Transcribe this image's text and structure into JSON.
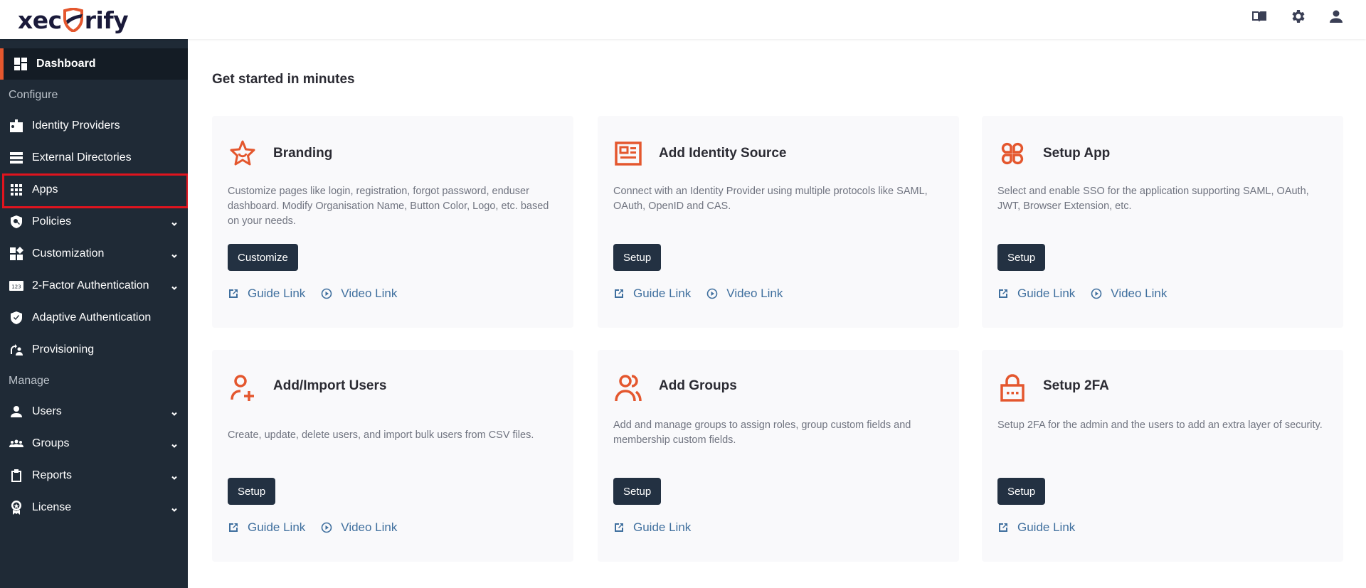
{
  "header": {
    "logo_left": "xec",
    "logo_right": "rify",
    "icons": [
      "book-icon",
      "gear-icon",
      "user-icon"
    ]
  },
  "sidebar": {
    "active": {
      "label": "Dashboard",
      "icon": "dashboard-icon"
    },
    "sections": [
      {
        "label": "Configure"
      },
      {
        "label": "Manage"
      }
    ],
    "items": [
      {
        "label": "Identity Providers",
        "icon": "id-badge-icon",
        "has_chevron": false
      },
      {
        "label": "External Directories",
        "icon": "server-list-icon",
        "has_chevron": false
      },
      {
        "label": "Apps",
        "icon": "grid-icon",
        "has_chevron": false,
        "highlighted": true
      },
      {
        "label": "Policies",
        "icon": "shield-search-icon",
        "has_chevron": true
      },
      {
        "label": "Customization",
        "icon": "widgets-icon",
        "has_chevron": true
      },
      {
        "label": "2-Factor Authentication",
        "icon": "numeric-123-icon",
        "has_chevron": true
      },
      {
        "label": "Adaptive Authentication",
        "icon": "shield-check-icon",
        "has_chevron": false
      },
      {
        "label": "Provisioning",
        "icon": "sync-user-icon",
        "has_chevron": false
      },
      {
        "label": "Users",
        "icon": "person-icon",
        "has_chevron": true
      },
      {
        "label": "Groups",
        "icon": "people-group-icon",
        "has_chevron": true
      },
      {
        "label": "Reports",
        "icon": "clipboard-icon",
        "has_chevron": true
      },
      {
        "label": "License",
        "icon": "award-icon",
        "has_chevron": true
      }
    ]
  },
  "main": {
    "title": "Get started in minutes",
    "guide_label": "Guide Link",
    "video_label": "Video Link",
    "cards": [
      {
        "title": "Branding",
        "icon": "star-icon",
        "description": "Customize pages like login, registration, forgot password, enduser dashboard. Modify Organisation Name, Button Color, Logo, etc. based on your needs.",
        "button": "Customize",
        "has_video": true
      },
      {
        "title": "Add Identity Source",
        "icon": "id-card-icon",
        "description": "Connect with an Identity Provider using multiple protocols like SAML, OAuth, OpenID and CAS.",
        "button": "Setup",
        "has_video": true
      },
      {
        "title": "Setup App",
        "icon": "apps-icon",
        "description": "Select and enable SSO for the application supporting SAML, OAuth, JWT, Browser Extension, etc.",
        "button": "Setup",
        "has_video": true
      },
      {
        "title": "Add/Import Users",
        "icon": "user-add-icon",
        "description": "Create, update, delete users, and import bulk users from CSV files.",
        "button": "Setup",
        "has_video": true
      },
      {
        "title": "Add Groups",
        "icon": "users-group-icon",
        "description": "Add and manage groups to assign roles, group custom fields and membership custom fields.",
        "button": "Setup",
        "has_video": false
      },
      {
        "title": "Setup 2FA",
        "icon": "lock-icon",
        "description": "Setup 2FA for the admin and the users to add an extra layer of security.",
        "button": "Setup",
        "has_video": false
      }
    ]
  },
  "colors": {
    "accent": "#e4572e",
    "sidebar_bg": "#1f2a36",
    "sidebar_active_bg": "#141c25",
    "button_bg": "#233142",
    "link": "#3f6f9e",
    "highlight": "#e0141e"
  }
}
